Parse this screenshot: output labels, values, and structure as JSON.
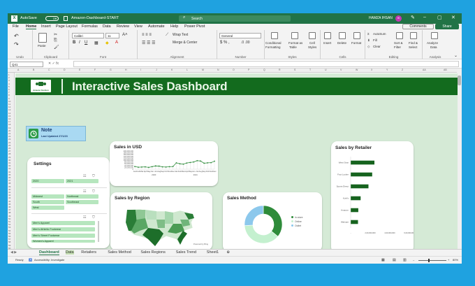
{
  "window": {
    "autosave": "AutoSave",
    "autosave_state": "Off",
    "filename": "Amazon-Dashboard-START",
    "search_placeholder": "Search",
    "user": "HAMZA IHSAN",
    "avatar": "HI"
  },
  "menu": [
    "File",
    "Home",
    "Insert",
    "Page Layout",
    "Formulas",
    "Data",
    "Review",
    "View",
    "Automate",
    "Help",
    "Power Pivot"
  ],
  "actions": {
    "comments": "Comments",
    "share": "Share"
  },
  "ribbon": {
    "undo_group": "Undo",
    "clipboard_group": "Clipboard",
    "paste": "Paste",
    "font_group": "Font",
    "font_name": "Calibri",
    "font_size": "11",
    "alignment_group": "Alignment",
    "wrap": "Wrap Text",
    "merge": "Merge & Center",
    "number_group": "Number",
    "number_format": "General",
    "styles_group": "Styles",
    "cond": "Conditional",
    "cond2": "Formatting",
    "fmt_table": "Format as",
    "fmt_table2": "Table",
    "cell_styles": "Cell",
    "cell_styles2": "Styles",
    "cells_group": "Cells",
    "insert": "Insert",
    "delete": "Delete",
    "format": "Format",
    "editing_group": "Editing",
    "autosum": "AutoSum",
    "fill": "Fill",
    "clear": "Clear",
    "sort": "Sort &",
    "sort2": "Filter",
    "find": "Find &",
    "find2": "Select",
    "analysis_group": "Analysis",
    "analyze": "Analyze",
    "analyze2": "Data"
  },
  "formula_bar": {
    "name_box": "Q41",
    "formula": ""
  },
  "columns": [
    "A",
    "B",
    "C",
    "D",
    "E",
    "F",
    "G",
    "H",
    "I",
    "J",
    "K",
    "L",
    "M",
    "N",
    "O",
    "P",
    "Q",
    "R",
    "S",
    "T",
    "U",
    "V",
    "W",
    "X",
    "Y",
    "Z",
    "AA",
    "AB"
  ],
  "dashboard": {
    "title": "Interactive Sales Dashboard",
    "logo_text": "Amazon Fashion"
  },
  "note": {
    "title": "Note",
    "subtitle": "Last Updated 27/1/23"
  },
  "settings": {
    "title": "Settings",
    "years": [
      "2020",
      "2021"
    ],
    "regions": [
      "Midwest",
      "Northeast",
      "South",
      "Southeast",
      "West"
    ],
    "products": [
      "Men's Apparel",
      "Men's Athletic Footwear",
      "Men's Street Footwear",
      "Women's Apparel"
    ]
  },
  "sales_usd": {
    "title": "Sales in USD"
  },
  "sales_region": {
    "title": "Sales by Region",
    "credit": "Powered by Bing"
  },
  "sales_method": {
    "title": "Sales Method"
  },
  "sales_retailer": {
    "title": "Sales by Retailer"
  },
  "sheet_tabs": [
    "Dashboard",
    "Data",
    "Retailers",
    "Sales Method",
    "Sales Regions",
    "Sales Trend",
    "Sheet1"
  ],
  "status": {
    "ready": "Ready",
    "accessibility": "Accessibility: Investigate",
    "zoom": "80%"
  },
  "colors": {
    "excel_green": "#217346",
    "dash_green": "#136b1e",
    "bar_green": "#16631e",
    "sky": "#1fa2e0"
  },
  "chart_data": [
    {
      "type": "line",
      "title": "Sales in USD",
      "x": [
        "Jan",
        "Feb",
        "Mar",
        "Apr",
        "May",
        "Jun",
        "Jul",
        "Aug",
        "Sep",
        "Oct",
        "Nov",
        "Dec",
        "Jan",
        "Feb",
        "Mar",
        "Apr",
        "May",
        "Jun",
        "Jul",
        "Aug",
        "Sep",
        "Oct",
        "Nov",
        "Dec"
      ],
      "groups": [
        "2020",
        "2021"
      ],
      "series": [
        {
          "values": [
            30000000,
            22000000,
            24000000,
            26000000,
            20000000,
            28000000,
            36000000,
            34000000,
            26000000,
            24000000,
            28000000,
            30000000,
            70000000,
            60000000,
            56000000,
            68000000,
            74000000,
            80000000,
            94000000,
            90000000,
            66000000,
            70000000,
            72000000,
            88000000
          ]
        }
      ],
      "ylim": [
        0,
        200000000
      ],
      "yticks": [
        "200,000,000",
        "180,000,000",
        "160,000,000",
        "140,000,000",
        "120,000,000",
        "100,000,000",
        "80,000,000",
        "60,000,000",
        "40,000,000",
        "20,000,000",
        "0"
      ]
    },
    {
      "type": "pie",
      "title": "Sales Method",
      "labels": [
        "In-store",
        "Online",
        "Outlet"
      ],
      "values": [
        36,
        38,
        26
      ],
      "colors": [
        "#2e8b3a",
        "#c4f0cf",
        "#8cc8ec"
      ]
    },
    {
      "type": "bar",
      "title": "Sales by Retailer",
      "categories": [
        "West Gear",
        "Foot Locker",
        "Sports Direct",
        "Kohl's",
        "Amazon",
        "Walmart"
      ],
      "values": [
        243000000,
        220000000,
        182000000,
        102000000,
        78000000,
        75000000
      ],
      "xticks": [
        "-",
        "2,00,000,000",
        "4,00,000,000",
        "6,00,000,000"
      ],
      "xlim": [
        0,
        600000000
      ]
    }
  ]
}
